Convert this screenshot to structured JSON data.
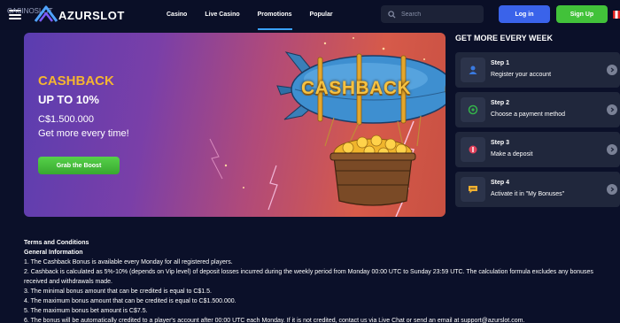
{
  "header": {
    "logo_text": "AZURSLOT",
    "logo_alt_text": "CASINOSLOT",
    "nav": [
      "Casino",
      "Live Casino",
      "Promotions",
      "Popular"
    ],
    "active_nav": "Promotions",
    "search_placeholder": "Search",
    "login_label": "Log in",
    "signup_label": "Sign Up"
  },
  "banner": {
    "title": "CASHBACK",
    "subtitle": "UP TO 10%",
    "amount": "C$1.500.000",
    "tagline": "Get more every time!",
    "cta_label": "Grab the Boost",
    "art_text": "CASHBACK"
  },
  "steps_panel": {
    "title": "GET MORE EVERY WEEK",
    "steps": [
      {
        "label": "Step 1",
        "text": "Register your account",
        "icon": "user-icon",
        "color": "#3a7ae0"
      },
      {
        "label": "Step 2",
        "text": "Choose a payment method",
        "icon": "payment-icon",
        "color": "#34b34a"
      },
      {
        "label": "Step 3",
        "text": "Make a deposit",
        "icon": "deposit-icon",
        "color": "#e0405a"
      },
      {
        "label": "Step 4",
        "text": "Activate it in \"My Bonuses\"",
        "icon": "bonus-icon",
        "color": "#f0b030"
      }
    ]
  },
  "terms": {
    "title": "Terms and Conditions",
    "subtitle": "General Information",
    "lines": [
      "1. The Cashback Bonus is available every Monday for all registered players.",
      "2. Cashback is calculated as 5%-10% (depends on Vip level) of deposit losses incurred during the weekly period from Monday 00:00 UTC to Sunday 23:59 UTC. The calculation formula excludes any bonuses",
      "received and withdrawals made.",
      "3. The minimal bonus amount that can be credited is equal to C$1.5.",
      "4. The maximum bonus amount that can be credited is equal to C$1.500.000.",
      "5. The maximum bonus bet amount is C$7.5.",
      "6. The bonus will be automatically credited to a player's account after 00:00 UTC each Monday. If it is not credited, contact us via Live Chat or send an email at support@azurslot.com."
    ]
  },
  "colors": {
    "background": "#0b1029",
    "accent_blue": "#3a63ea",
    "accent_green": "#42c23a",
    "cashback_gold": "#f5b531"
  }
}
